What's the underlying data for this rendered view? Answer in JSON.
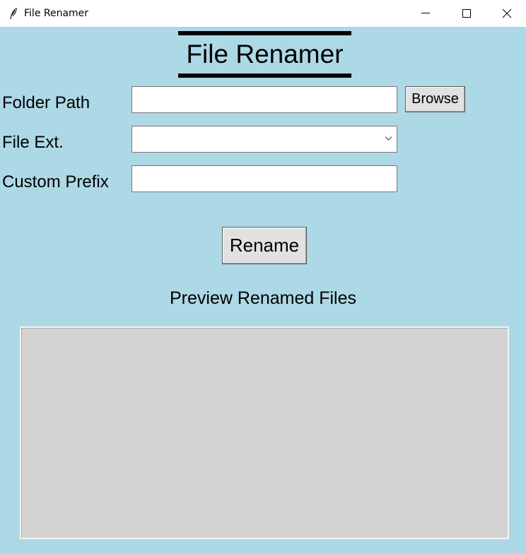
{
  "window": {
    "title": "File Renamer",
    "controls": [
      "minimize-icon",
      "maximize-icon",
      "close-icon"
    ]
  },
  "heading": "File Renamer",
  "form": {
    "folder_label": "Folder Path",
    "folder_value": "",
    "browse_label": "Browse",
    "ext_label": "File Ext.",
    "ext_value": "",
    "prefix_label": "Custom Prefix",
    "prefix_value": ""
  },
  "rename_label": "Rename",
  "preview": {
    "label": "Preview Renamed Files",
    "items": []
  },
  "colors": {
    "background": "#add8e6",
    "preview_bg": "#d3d3d3",
    "button_bg": "#e1e1e1"
  }
}
